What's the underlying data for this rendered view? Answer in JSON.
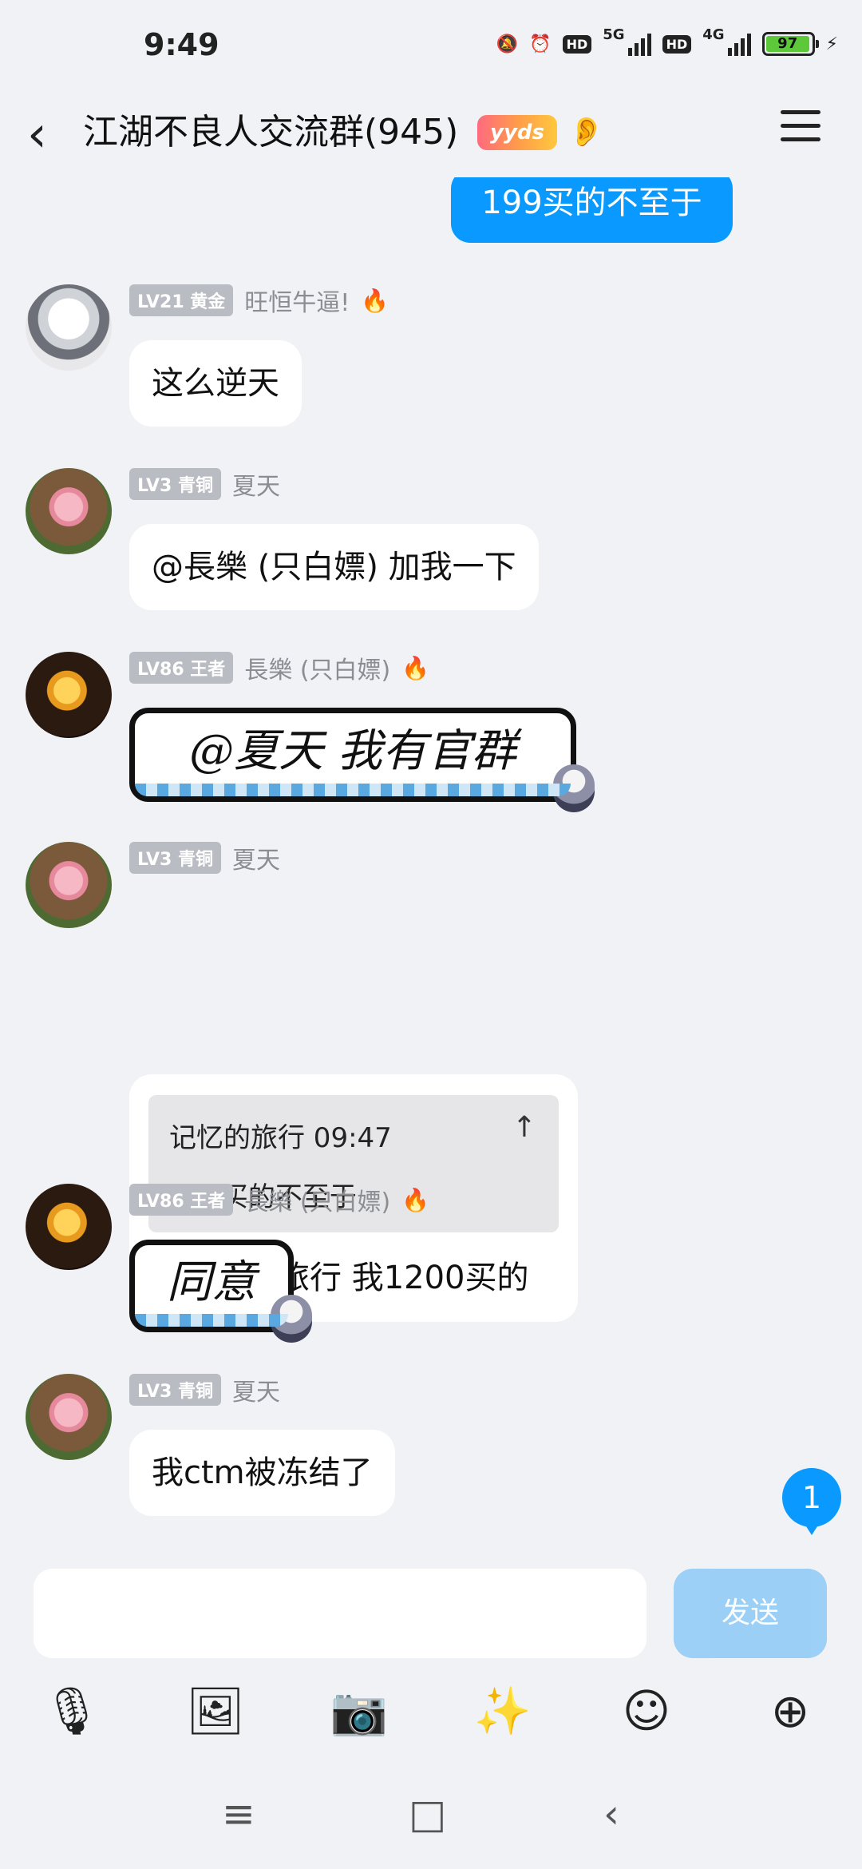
{
  "status_bar": {
    "time": "9:49",
    "hd1": "HD",
    "net1": "5G",
    "hd2": "HD",
    "net2": "4G",
    "battery": "97"
  },
  "header": {
    "title": "江湖不良人交流群(945)",
    "badge": "yyds"
  },
  "messages": {
    "outgoing_top": "199买的不至于",
    "m1": {
      "level": "LV21 黄金",
      "name": "旺恒牛逼!",
      "text": "这么逆天"
    },
    "m2": {
      "level": "LV3 青铜",
      "name": "夏天",
      "text": "@長樂 (只白嫖) 加我一下"
    },
    "m3": {
      "level": "LV86 王者",
      "name": "長樂 (只白嫖)",
      "sticker": "@夏天 我有官群"
    },
    "m4": {
      "level": "LV3 青铜",
      "name": "夏天",
      "quote_header": "记忆的旅行 09:47",
      "quote_body": "199买的不至于",
      "text": "@记忆的旅行 我1200买的"
    },
    "m5": {
      "level": "LV86 王者",
      "name": "長樂 (只白嫖)",
      "sticker": "同意"
    },
    "m6": {
      "level": "LV3 青铜",
      "name": "夏天",
      "text": "我ctm被冻结了"
    }
  },
  "unread_count": "1",
  "composer": {
    "send_label": "发送"
  },
  "colors": {
    "accent": "#0a99ff",
    "background": "#f1f2f6"
  }
}
